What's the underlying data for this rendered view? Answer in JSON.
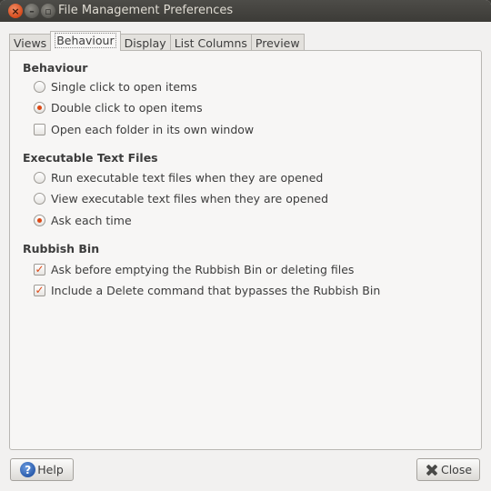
{
  "window": {
    "title": "File Management Preferences",
    "controls": {
      "close_icon": "close-icon",
      "minimize_icon": "minimize-icon",
      "maximize_icon": "maximize-icon"
    }
  },
  "tabs": [
    {
      "label": "Views",
      "active": false
    },
    {
      "label": "Behaviour",
      "active": true
    },
    {
      "label": "Display",
      "active": false
    },
    {
      "label": "List Columns",
      "active": false
    },
    {
      "label": "Preview",
      "active": false
    }
  ],
  "behaviour": {
    "title": "Behaviour",
    "single_click": {
      "label": "Single click to open items",
      "checked": false
    },
    "double_click": {
      "label": "Double click to open items",
      "checked": true
    },
    "own_window": {
      "label": "Open each folder in its own window",
      "checked": false
    }
  },
  "executable": {
    "title": "Executable Text Files",
    "run": {
      "label": "Run executable text files when they are opened",
      "checked": false
    },
    "view": {
      "label": "View executable text files when they are opened",
      "checked": false
    },
    "ask": {
      "label": "Ask each time",
      "checked": true
    }
  },
  "rubbish": {
    "title": "Rubbish Bin",
    "ask_before_empty": {
      "label": "Ask before emptying the Rubbish Bin or deleting files",
      "checked": true
    },
    "delete_command": {
      "label": "Include a Delete command that bypasses the Rubbish Bin",
      "checked": true
    }
  },
  "buttons": {
    "help": "Help",
    "close": "Close"
  },
  "colors": {
    "titlebar": "#3c3b37",
    "accent": "#dd4814",
    "window_bg": "#f2f1f0"
  }
}
